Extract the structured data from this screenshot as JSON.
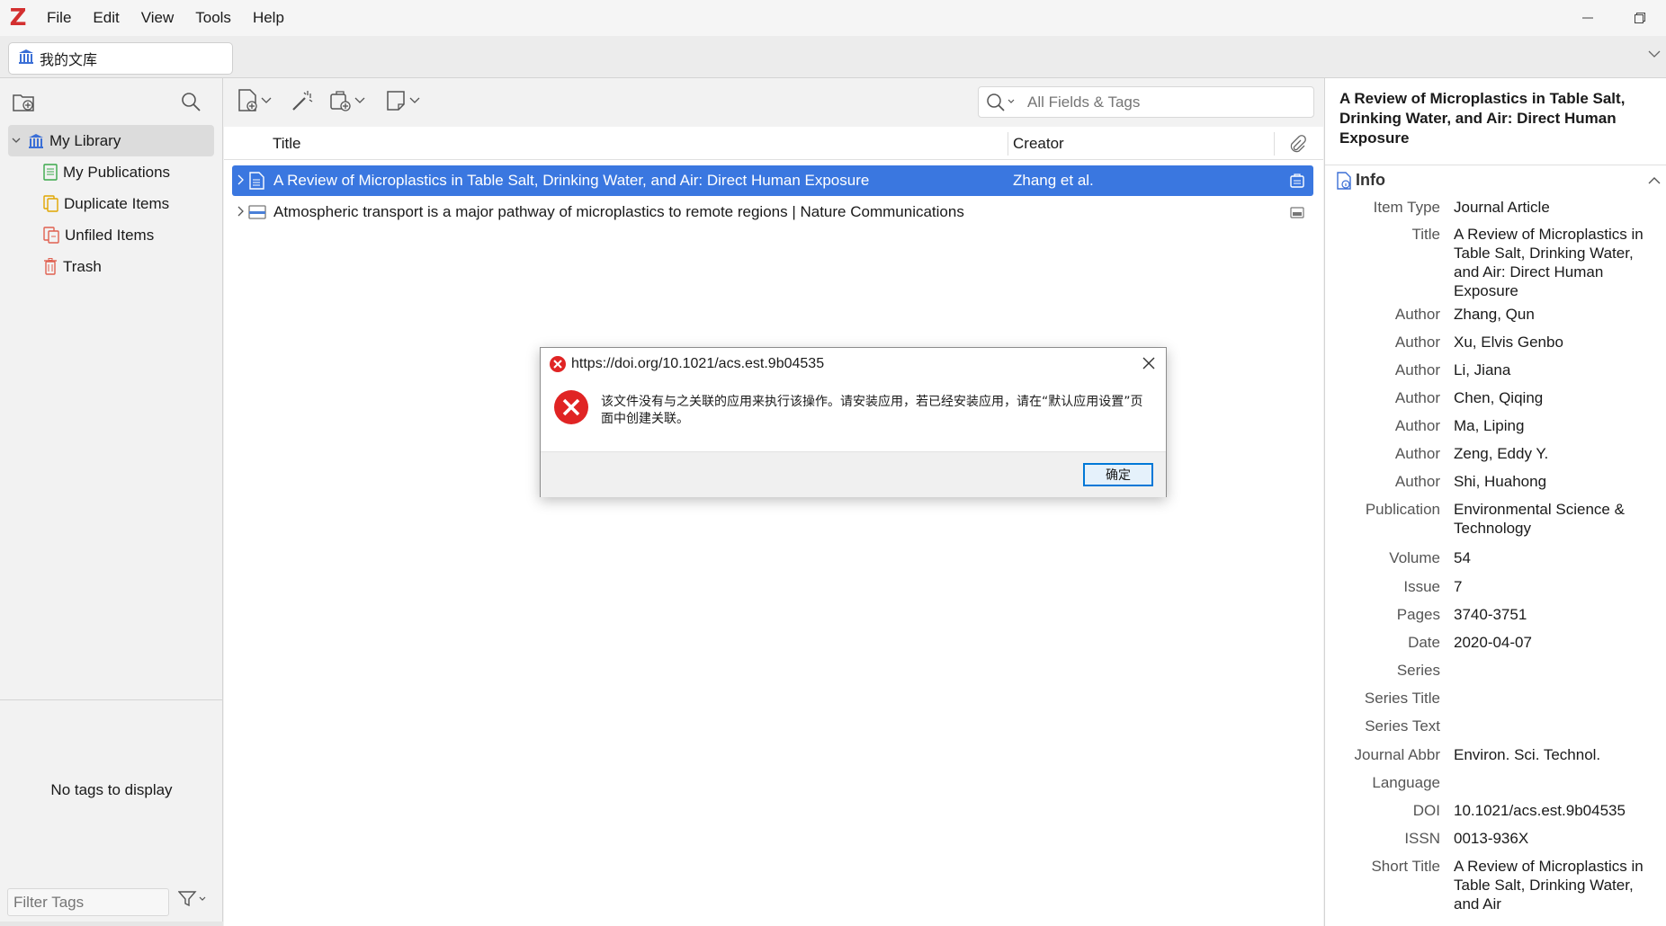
{
  "app": {
    "logo": "Z",
    "menus": [
      "File",
      "Edit",
      "View",
      "Tools",
      "Help"
    ]
  },
  "tab": {
    "label": "我的文库",
    "icon": "library-icon"
  },
  "collections": {
    "root": "My Library",
    "children": [
      "My Publications",
      "Duplicate Items",
      "Unfiled Items",
      "Trash"
    ]
  },
  "tags": {
    "empty_message": "No tags to display",
    "filter_placeholder": "Filter Tags"
  },
  "search": {
    "placeholder": "All Fields & Tags"
  },
  "columns": {
    "title": "Title",
    "creator": "Creator"
  },
  "items": [
    {
      "title": "A Review of Microplastics in Table Salt, Drinking Water, and Air: Direct Human Exposure",
      "creator": "Zhang et al.",
      "selected": true,
      "type_icon": "journal-article-icon"
    },
    {
      "title": "Atmospheric transport is a major pathway of microplastics to remote regions | Nature Communications",
      "creator": "",
      "selected": false,
      "type_icon": "webpage-icon"
    }
  ],
  "item_pane": {
    "heading": "A Review of Microplastics in Table Salt, Drinking Water, and Air: Direct Human Exposure",
    "section": "Info",
    "fields": [
      {
        "label": "Item Type",
        "value": "Journal Article"
      },
      {
        "label": "Title",
        "value": "A Review of Microplastics in Table Salt, Drinking Water, and Air: Direct Human Exposure"
      },
      {
        "label": "Author",
        "value": "Zhang, Qun"
      },
      {
        "label": "Author",
        "value": "Xu, Elvis Genbo"
      },
      {
        "label": "Author",
        "value": "Li, Jiana"
      },
      {
        "label": "Author",
        "value": "Chen, Qiqing"
      },
      {
        "label": "Author",
        "value": "Ma, Liping"
      },
      {
        "label": "Author",
        "value": "Zeng, Eddy Y."
      },
      {
        "label": "Author",
        "value": "Shi, Huahong"
      },
      {
        "label": "Publication",
        "value": "Environmental Science & Technology"
      },
      {
        "label": "Volume",
        "value": "54"
      },
      {
        "label": "Issue",
        "value": "7"
      },
      {
        "label": "Pages",
        "value": "3740-3751"
      },
      {
        "label": "Date",
        "value": "2020-04-07"
      },
      {
        "label": "Series",
        "value": ""
      },
      {
        "label": "Series Title",
        "value": ""
      },
      {
        "label": "Series Text",
        "value": ""
      },
      {
        "label": "Journal Abbr",
        "value": "Environ. Sci. Technol."
      },
      {
        "label": "Language",
        "value": ""
      },
      {
        "label": "DOI",
        "value": "10.1021/acs.est.9b04535"
      },
      {
        "label": "ISSN",
        "value": "0013-936X"
      },
      {
        "label": "Short Title",
        "value": "A Review of Microplastics in Table Salt, Drinking Water, and Air"
      }
    ]
  },
  "dialog": {
    "title": "https://doi.org/10.1021/acs.est.9b04535",
    "message": "该文件没有与之关联的应用来执行该操作。请安装应用，若已经安装应用，请在“默认应用设置”页面中创建关联。",
    "ok_label": "确定"
  },
  "colors": {
    "accent": "#3a77e0",
    "error": "#e02424",
    "logo": "#d32f2f"
  }
}
